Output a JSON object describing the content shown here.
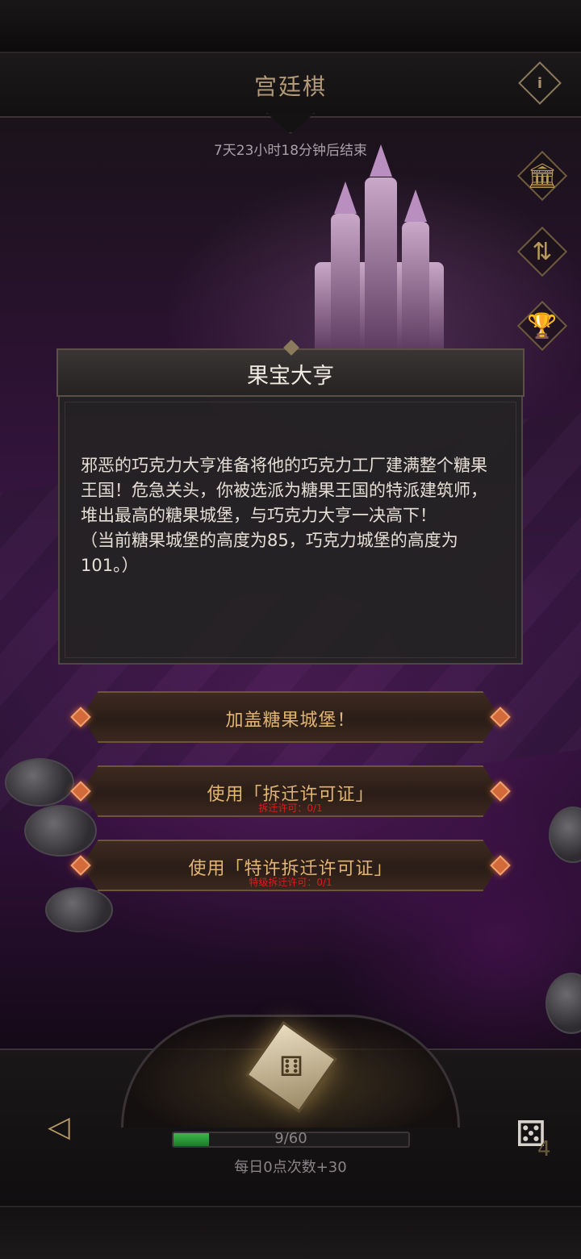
{
  "header": {
    "title": "宫廷棋",
    "info_icon": "info-icon",
    "countdown": "7天23小时18分钟后结束"
  },
  "side_icons": [
    {
      "name": "shop-icon",
      "glyph": "🏛"
    },
    {
      "name": "swap-arrows-icon",
      "glyph": "⇅"
    },
    {
      "name": "trophy-icon",
      "glyph": "🏆"
    }
  ],
  "dialog": {
    "title": "果宝大亨",
    "body": "邪恶的巧克力大亨准备将他的巧克力工厂建满整个糖果王国！危急关头，你被选派为糖果王国的特派建筑师，堆出最高的糖果城堡，与巧克力大亨一决高下！\n（当前糖果城堡的高度为85，巧克力城堡的高度为101。）"
  },
  "actions": {
    "build": {
      "label": "加盖糖果城堡！"
    },
    "demolish": {
      "label": "使用「拆迁许可证」",
      "sub": "拆迁许可：0/1"
    },
    "special_demolish": {
      "label": "使用「特许拆迁许可证」",
      "sub": "特级拆迁许可：0/1"
    }
  },
  "bottom": {
    "progress": {
      "current": 9,
      "max": 60,
      "text": "9/60"
    },
    "daily_text": "每日0点次数+30",
    "roll_count": "4",
    "dice_icon": "dice-icon",
    "back_icon": "back-arrow-icon"
  },
  "colors": {
    "accent_gold": "#e3b573",
    "warning_red": "#e01c1c",
    "progress_green": "#3cb84a"
  }
}
